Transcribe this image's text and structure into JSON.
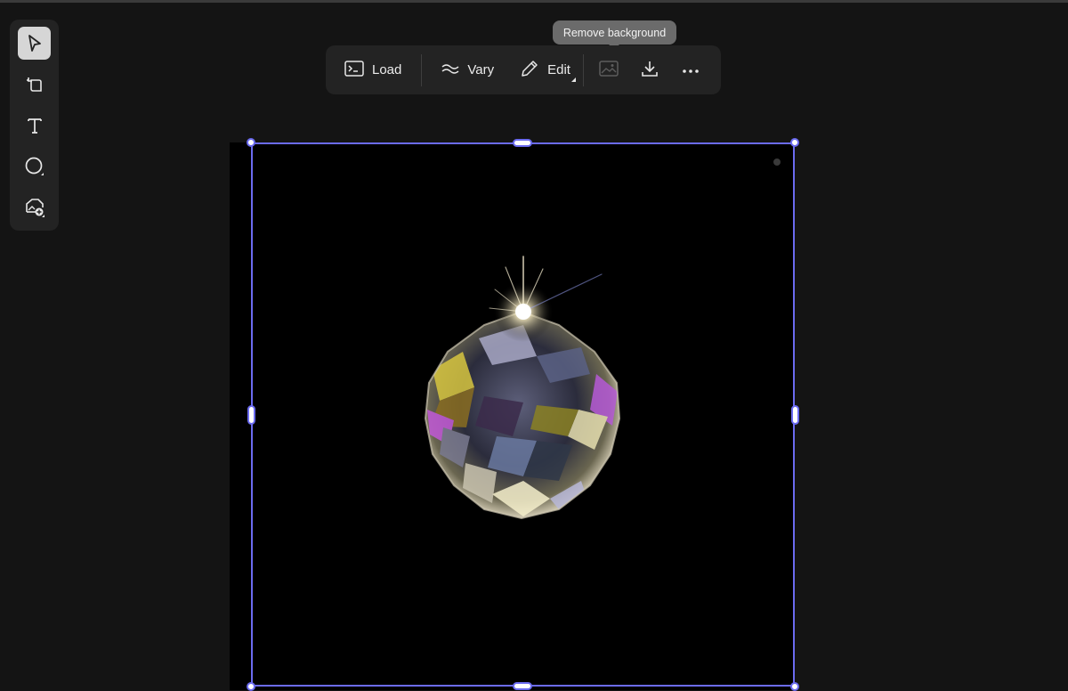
{
  "toolbar": {
    "load_label": "Load",
    "vary_label": "Vary",
    "edit_label": "Edit"
  },
  "tooltip": {
    "text": "Remove background"
  },
  "tools": [
    {
      "icon": "select-arrow-icon",
      "active": true
    },
    {
      "icon": "crop-rotate-icon",
      "active": false
    },
    {
      "icon": "text-icon",
      "active": false
    },
    {
      "icon": "shape-circle-icon",
      "active": false
    },
    {
      "icon": "add-image-icon",
      "active": false
    }
  ],
  "colors": {
    "background": "#141414",
    "panel": "#232323",
    "selection": "#6b6bf0",
    "tooltip": "#6b6b6b"
  },
  "canvas": {
    "image": "crystal-ball-on-black"
  }
}
